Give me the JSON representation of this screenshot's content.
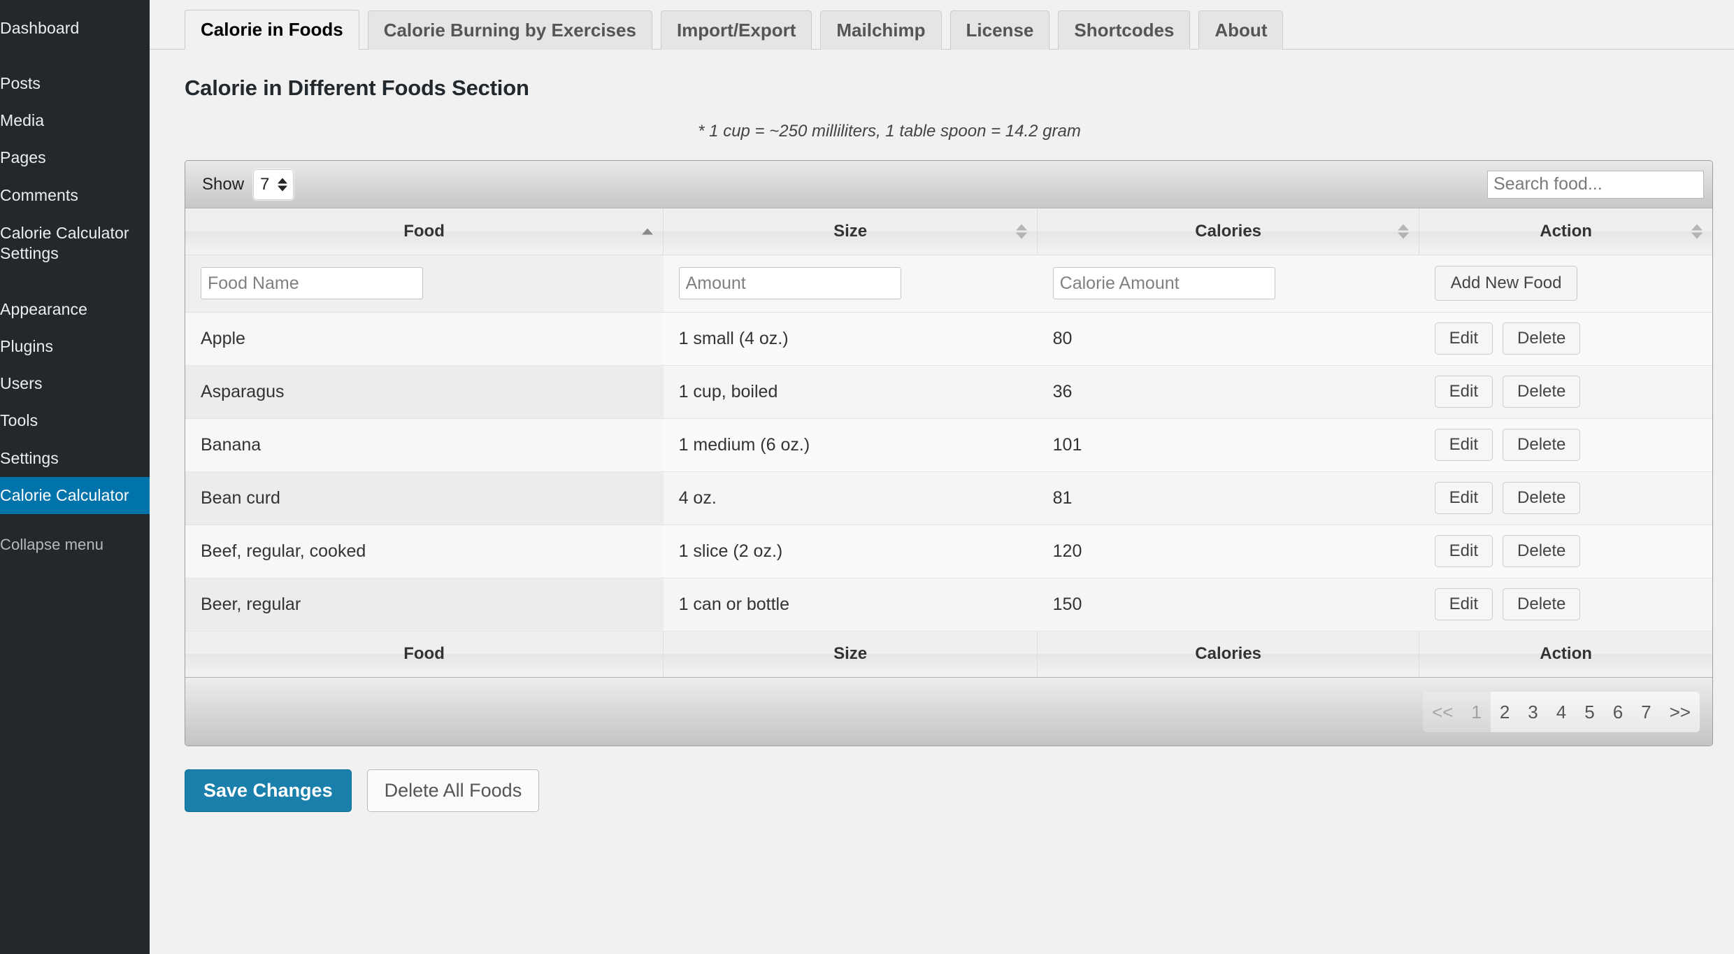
{
  "sidebar": {
    "items": [
      {
        "label": "Dashboard",
        "active": false,
        "gap": false
      },
      {
        "label": "Posts",
        "active": false,
        "gap": true
      },
      {
        "label": "Media",
        "active": false,
        "gap": false
      },
      {
        "label": "Pages",
        "active": false,
        "gap": false
      },
      {
        "label": "Comments",
        "active": false,
        "gap": false
      },
      {
        "label": "Calorie Calculator Settings",
        "active": false,
        "gap": false
      },
      {
        "label": "Appearance",
        "active": false,
        "gap": true
      },
      {
        "label": "Plugins",
        "active": false,
        "gap": false
      },
      {
        "label": "Users",
        "active": false,
        "gap": false
      },
      {
        "label": "Tools",
        "active": false,
        "gap": false
      },
      {
        "label": "Settings",
        "active": false,
        "gap": false
      },
      {
        "label": "Calorie Calculator",
        "active": true,
        "gap": false
      }
    ],
    "collapse_label": "Collapse menu"
  },
  "tabs": [
    {
      "label": "Calorie in Foods",
      "active": true
    },
    {
      "label": "Calorie Burning by Exercises",
      "active": false
    },
    {
      "label": "Import/Export",
      "active": false
    },
    {
      "label": "Mailchimp",
      "active": false
    },
    {
      "label": "License",
      "active": false
    },
    {
      "label": "Shortcodes",
      "active": false
    },
    {
      "label": "About",
      "active": false
    }
  ],
  "page": {
    "title": "Calorie in Different Foods Section",
    "note": "* 1 cup = ~250 milliliters, 1 table spoon = 14.2 gram"
  },
  "toolbar": {
    "show_label": "Show",
    "show_value": "7",
    "search_placeholder": "Search food..."
  },
  "table": {
    "headers": [
      {
        "label": "Food",
        "sort": "asc"
      },
      {
        "label": "Size",
        "sort": "none"
      },
      {
        "label": "Calories",
        "sort": "none"
      },
      {
        "label": "Action",
        "sort": "none"
      }
    ],
    "footer_headers": [
      "Food",
      "Size",
      "Calories",
      "Action"
    ],
    "new_row": {
      "food_placeholder": "Food Name",
      "size_placeholder": "Amount",
      "calorie_placeholder": "Calorie Amount",
      "add_label": "Add New Food"
    },
    "row_actions": {
      "edit": "Edit",
      "delete": "Delete"
    },
    "rows": [
      {
        "food": "Apple",
        "size": "1 small (4 oz.)",
        "calories": "80"
      },
      {
        "food": "Asparagus",
        "size": "1 cup, boiled",
        "calories": "36"
      },
      {
        "food": "Banana",
        "size": "1 medium (6 oz.)",
        "calories": "101"
      },
      {
        "food": "Bean curd",
        "size": "4 oz.",
        "calories": "81"
      },
      {
        "food": "Beef, regular, cooked",
        "size": "1 slice (2 oz.)",
        "calories": "120"
      },
      {
        "food": "Beer, regular",
        "size": "1 can or bottle",
        "calories": "150"
      }
    ]
  },
  "pagination": {
    "prev": "<<",
    "next": ">>",
    "pages": [
      "1",
      "2",
      "3",
      "4",
      "5",
      "6",
      "7"
    ],
    "current": "1"
  },
  "footer_buttons": {
    "save": "Save Changes",
    "delete_all": "Delete All Foods"
  },
  "colors": {
    "sidebar_bg": "#23282d",
    "accent": "#0073aa",
    "primary_button": "#1a7fab",
    "page_bg": "#f1f1f1"
  }
}
